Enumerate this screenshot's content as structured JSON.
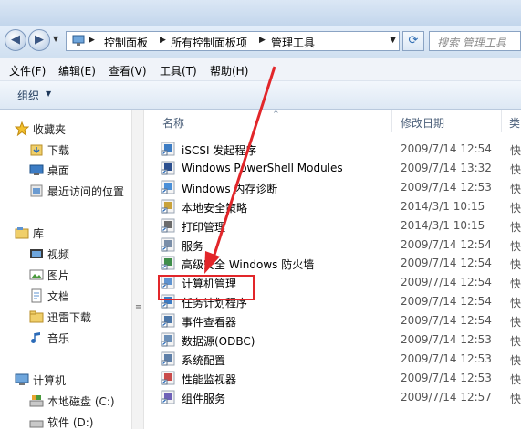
{
  "address_bar": {
    "breadcrumbs": [
      "控制面板",
      "所有控制面板项",
      "管理工具"
    ],
    "search_placeholder": "搜索 管理工具"
  },
  "menu": [
    "文件(F)",
    "编辑(E)",
    "查看(V)",
    "工具(T)",
    "帮助(H)"
  ],
  "toolbar": {
    "organize_label": "组织"
  },
  "nav": {
    "favorites": {
      "label": "收藏夹",
      "items": [
        "下载",
        "桌面",
        "最近访问的位置"
      ]
    },
    "libraries": {
      "label": "库",
      "items": [
        "视频",
        "图片",
        "文档",
        "迅雷下载",
        "音乐"
      ]
    },
    "computer": {
      "label": "计算机",
      "items": [
        "本地磁盘 (C:)",
        "软件 (D:)"
      ]
    }
  },
  "columns": {
    "name": "名称",
    "date": "修改日期",
    "type": "类"
  },
  "files": [
    {
      "name": "iSCSI 发起程序",
      "date": "2009/7/14 12:54",
      "type": "快"
    },
    {
      "name": "Windows PowerShell Modules",
      "date": "2009/7/14 13:32",
      "type": "快"
    },
    {
      "name": "Windows 内存诊断",
      "date": "2009/7/14 12:53",
      "type": "快"
    },
    {
      "name": "本地安全策略",
      "date": "2014/3/1 10:15",
      "type": "快"
    },
    {
      "name": "打印管理",
      "date": "2014/3/1 10:15",
      "type": "快"
    },
    {
      "name": "服务",
      "date": "2009/7/14 12:54",
      "type": "快"
    },
    {
      "name": "高级安全 Windows 防火墙",
      "date": "2009/7/14 12:54",
      "type": "快"
    },
    {
      "name": "计算机管理",
      "date": "2009/7/14 12:54",
      "type": "快"
    },
    {
      "name": "任务计划程序",
      "date": "2009/7/14 12:54",
      "type": "快"
    },
    {
      "name": "事件查看器",
      "date": "2009/7/14 12:54",
      "type": "快"
    },
    {
      "name": "数据源(ODBC)",
      "date": "2009/7/14 12:53",
      "type": "快"
    },
    {
      "name": "系统配置",
      "date": "2009/7/14 12:53",
      "type": "快"
    },
    {
      "name": "性能监视器",
      "date": "2009/7/14 12:53",
      "type": "快"
    },
    {
      "name": "组件服务",
      "date": "2009/7/14 12:57",
      "type": "快"
    }
  ],
  "colors": {
    "annotation_red": "#e2262a",
    "toolbar_text": "#1e395b"
  }
}
